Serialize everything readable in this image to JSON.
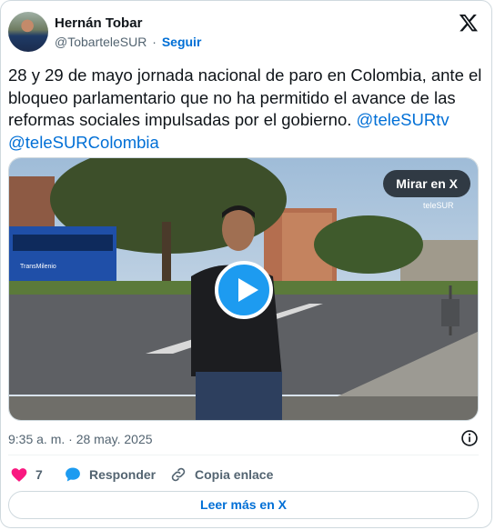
{
  "author": {
    "name": "Hernán Tobar",
    "handle": "@TobarteleSUR",
    "separator": "·",
    "follow_label": "Seguir"
  },
  "tweet": {
    "text": "28 y 29 de mayo jornada nacional de paro en Colombia, ante el bloqueo parlamentario que no ha permitido el avance de las reformas sociales impulsadas por el gobierno.",
    "mentions": [
      "@teleSURtv",
      "@teleSURColombia"
    ]
  },
  "media": {
    "watch_label": "Mirar en X",
    "watermark": "teleSUR",
    "bus_text": "TransMilenio"
  },
  "meta": {
    "time": "9:35 a. m.",
    "separator": "·",
    "date": "28 may. 2025"
  },
  "actions": {
    "like_count": "7",
    "reply_label": "Responder",
    "copy_label": "Copia enlace"
  },
  "read_more_label": "Leer más en X",
  "colors": {
    "link": "#006fd6",
    "like": "#f91880",
    "reply": "#1d9bf0",
    "play": "#1d9bf0"
  },
  "icons": [
    "x-logo-icon",
    "play-icon",
    "info-icon",
    "heart-icon",
    "reply-bubble-icon",
    "link-icon"
  ]
}
